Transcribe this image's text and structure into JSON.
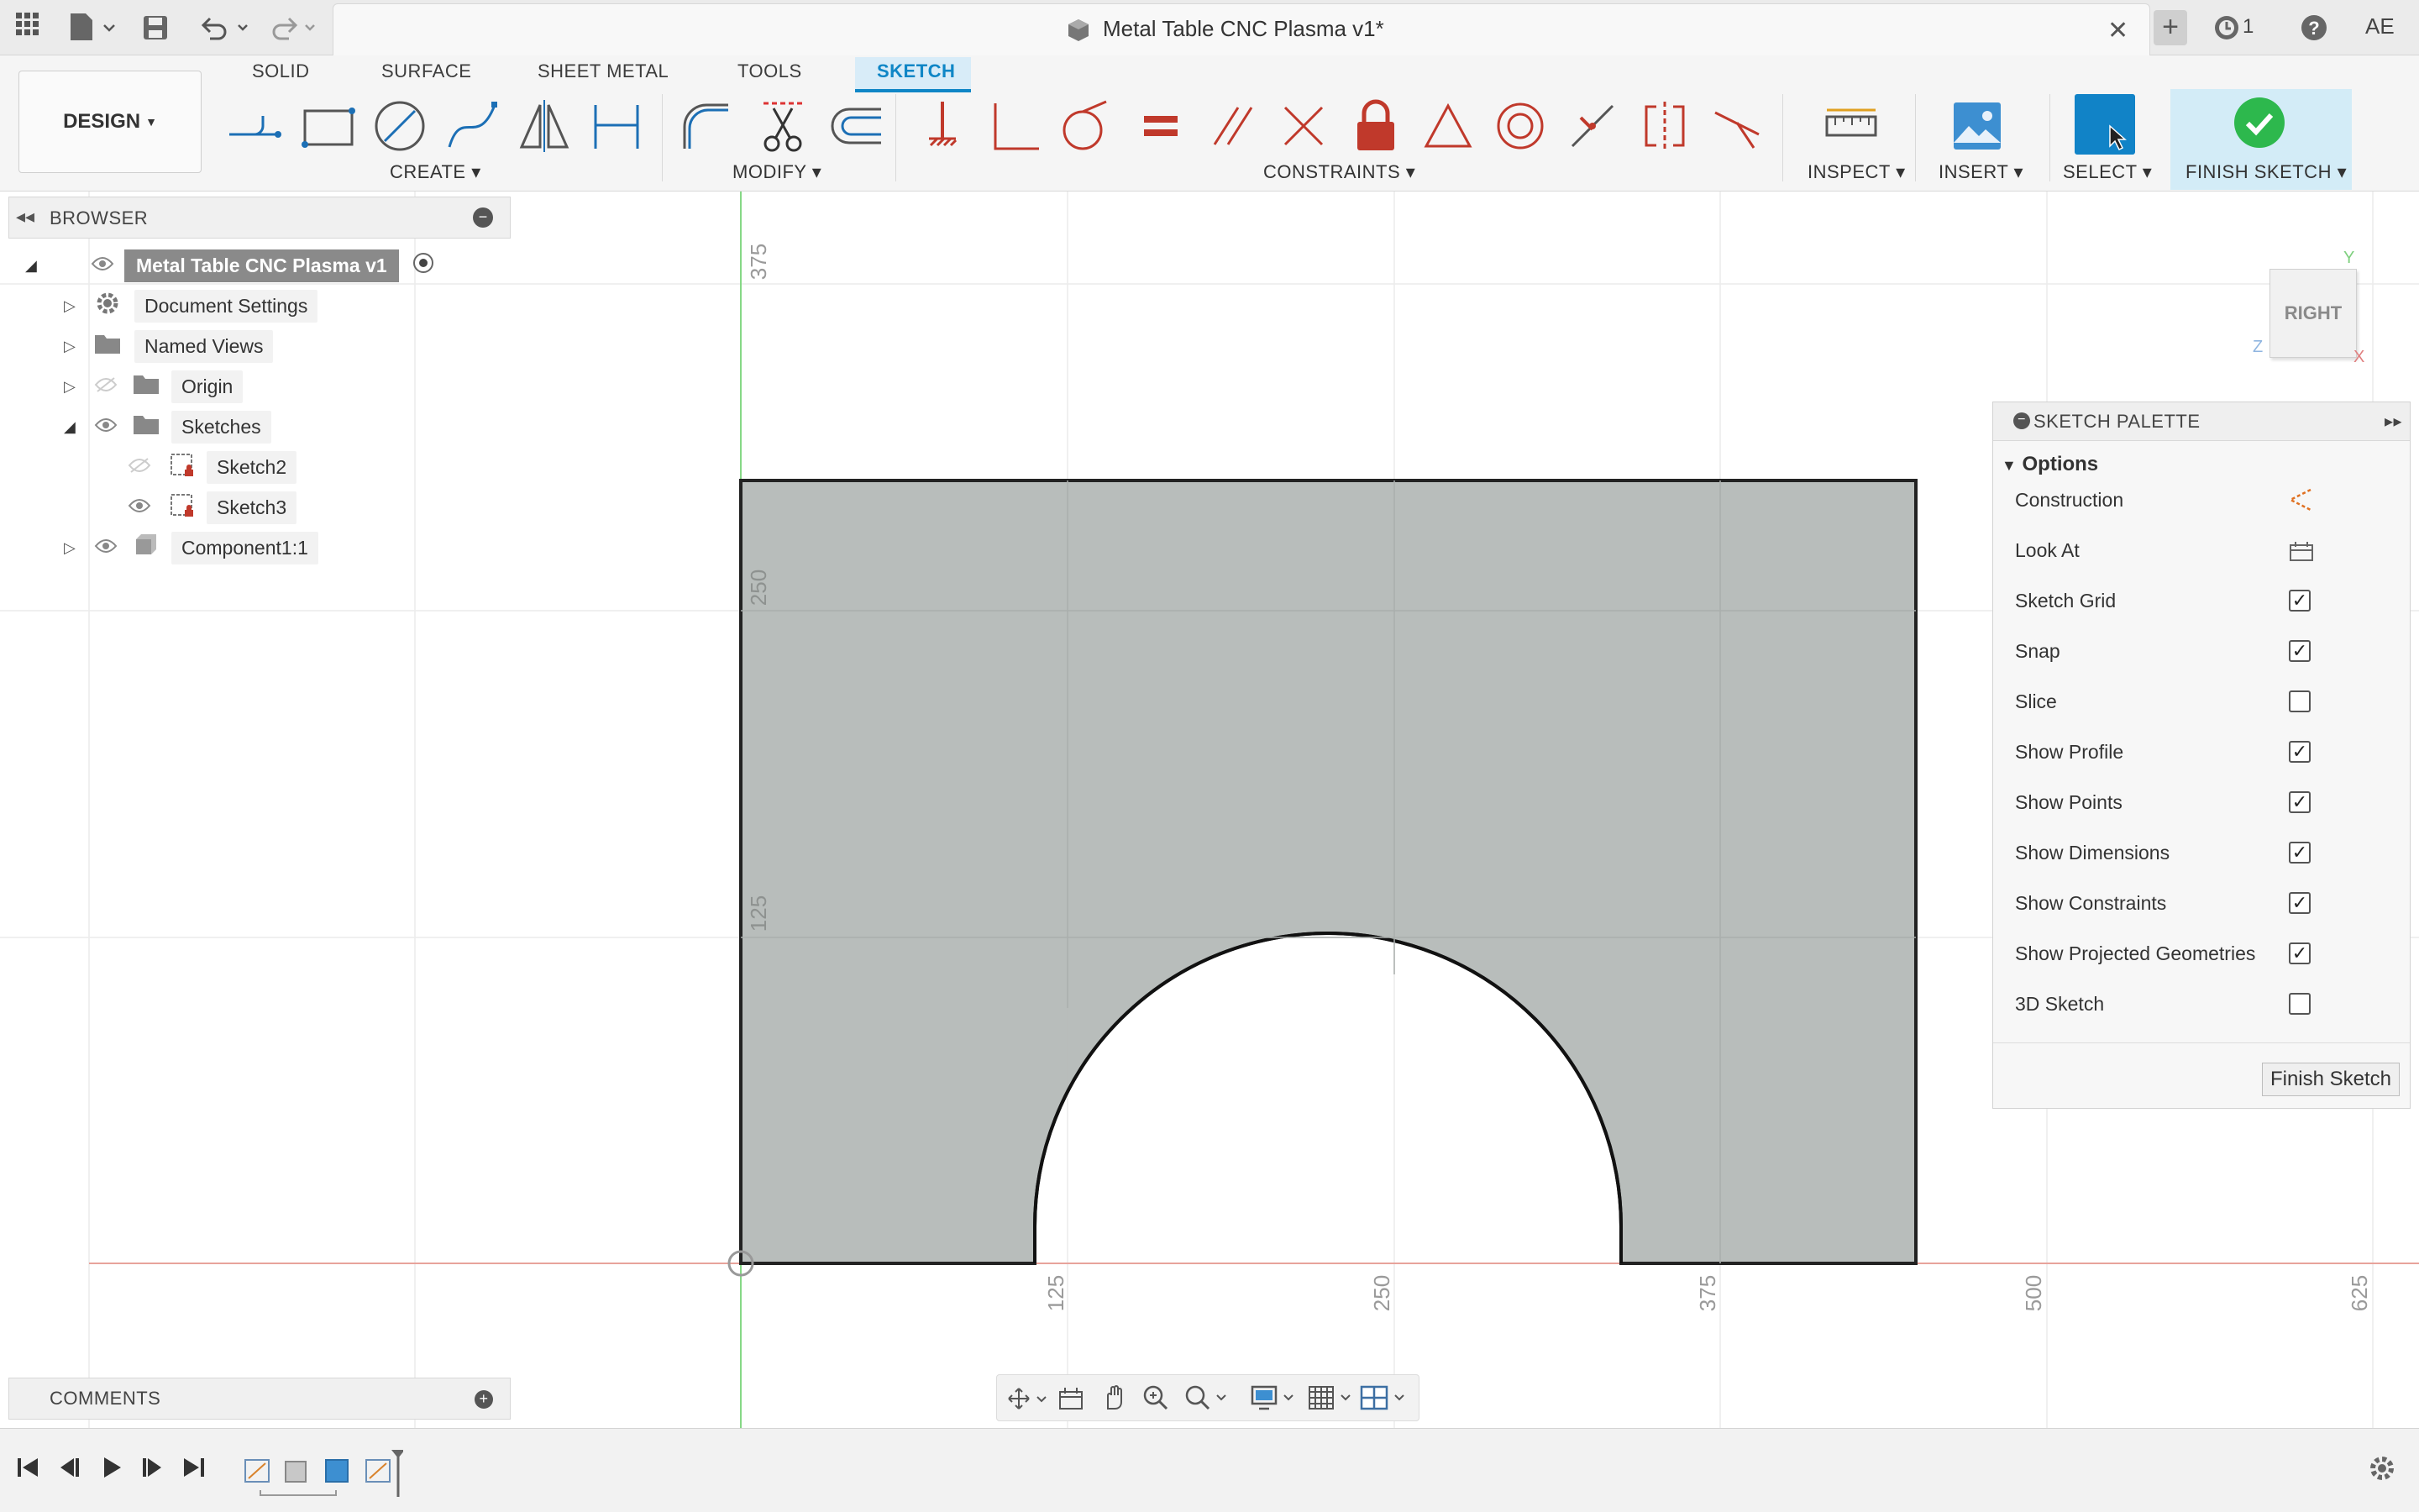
{
  "title_bar": {
    "document_title": "Metal Table CNC Plasma v1*",
    "job_count": "1",
    "user_initials": "AE"
  },
  "toolbar": {
    "workspace_label": "DESIGN",
    "tabs": [
      "SOLID",
      "SURFACE",
      "SHEET METAL",
      "TOOLS",
      "SKETCH"
    ],
    "active_tab": "SKETCH",
    "groups": {
      "create": "CREATE",
      "modify": "MODIFY",
      "constraints": "CONSTRAINTS",
      "inspect": "INSPECT",
      "insert": "INSERT",
      "select": "SELECT",
      "finish": "FINISH SKETCH"
    }
  },
  "browser": {
    "title": "BROWSER",
    "root": "Metal Table CNC Plasma v1",
    "items": [
      {
        "label": "Document Settings"
      },
      {
        "label": "Named Views"
      },
      {
        "label": "Origin"
      },
      {
        "label": "Sketches"
      },
      {
        "label": "Sketch2"
      },
      {
        "label": "Sketch3"
      },
      {
        "label": "Component1:1"
      }
    ]
  },
  "canvas": {
    "view_cube_label": "RIGHT",
    "axis_labels": {
      "y": "Y",
      "z": "Z",
      "x": "X"
    },
    "ruler_horizontal": [
      "125",
      "250",
      "375",
      "500",
      "625"
    ],
    "ruler_vertical": [
      "375",
      "250",
      "125"
    ]
  },
  "sketch_palette": {
    "title": "SKETCH PALETTE",
    "section": "Options",
    "options": [
      {
        "label": "Construction",
        "control": "icon",
        "icon": "construction-triangle-icon"
      },
      {
        "label": "Look At",
        "control": "icon",
        "icon": "look-at-icon"
      },
      {
        "label": "Sketch Grid",
        "control": "checkbox",
        "checked": true
      },
      {
        "label": "Snap",
        "control": "checkbox",
        "checked": true
      },
      {
        "label": "Slice",
        "control": "checkbox",
        "checked": false
      },
      {
        "label": "Show Profile",
        "control": "checkbox",
        "checked": true
      },
      {
        "label": "Show Points",
        "control": "checkbox",
        "checked": true
      },
      {
        "label": "Show Dimensions",
        "control": "checkbox",
        "checked": true
      },
      {
        "label": "Show Constraints",
        "control": "checkbox",
        "checked": true
      },
      {
        "label": "Show Projected Geometries",
        "control": "checkbox",
        "checked": true
      },
      {
        "label": "3D Sketch",
        "control": "checkbox",
        "checked": false
      }
    ],
    "finish_button": "Finish Sketch"
  },
  "comments": {
    "title": "COMMENTS"
  },
  "colors": {
    "accent": "#0f86c6",
    "sketch_fill": "#b3b8b6",
    "constraint_red": "#c0392b",
    "axis_green": "#7dd87d",
    "axis_red": "#e8a39b"
  }
}
